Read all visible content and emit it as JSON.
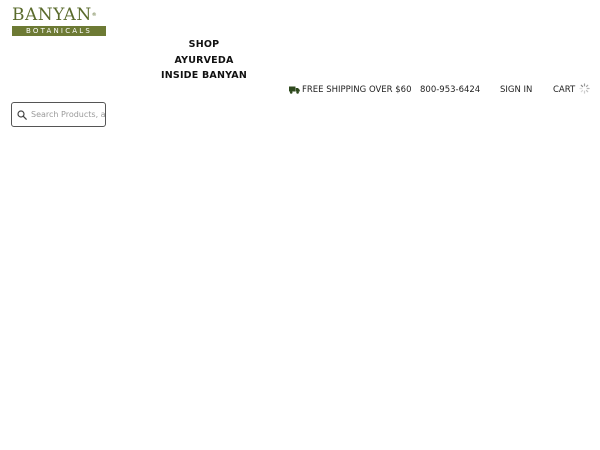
{
  "logo": {
    "word": "BANYAN",
    "mark": "®",
    "tagline": "BOTANICALS"
  },
  "nav": {
    "items": [
      {
        "label": "SHOP"
      },
      {
        "label": "AYURVEDA"
      },
      {
        "label": "INSIDE BANYAN"
      }
    ]
  },
  "utility": {
    "shipping": "FREE SHIPPING OVER $60",
    "phone": "800-953-6424",
    "sign_in": "SIGN IN",
    "cart": "CART"
  },
  "search": {
    "placeholder": "Search Products, a",
    "value": ""
  },
  "colors": {
    "brand_green": "#6d7a34",
    "text": "#1a1a1a",
    "background": "#ffffff"
  },
  "icons": {
    "shipping": "truck-icon",
    "search": "search-icon",
    "cart_loading": "spinner-icon"
  }
}
